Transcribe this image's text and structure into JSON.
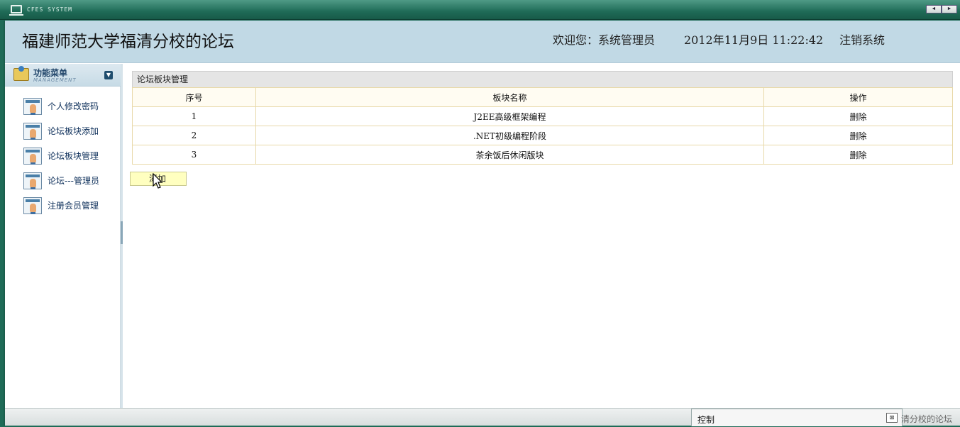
{
  "window": {
    "system_title": "CFES SYSTEM",
    "nav_prev": "◄",
    "nav_next": "►"
  },
  "header": {
    "site_title": "福建师范大学福清分校的论坛",
    "welcome": "欢迎您：系统管理员",
    "datetime": "2012年11月9日  11:22:42",
    "logout": "注销系统"
  },
  "sidebar": {
    "menu_title": "功能菜单",
    "menu_subtitle": "MANAGEMENT",
    "items": [
      {
        "label": "个人修改密码"
      },
      {
        "label": "论坛板块添加"
      },
      {
        "label": "论坛板块管理"
      },
      {
        "label": "论坛---管理员"
      },
      {
        "label": "注册会员管理"
      }
    ]
  },
  "main": {
    "panel_title": "论坛板块管理",
    "table": {
      "headers": [
        "序号",
        "板块名称",
        "操作"
      ],
      "rows": [
        {
          "no": "1",
          "name": "J2EE高级框架编程",
          "action": "删除"
        },
        {
          "no": "2",
          "name": ".NET初级编程阶段",
          "action": "删除"
        },
        {
          "no": "3",
          "name": "茶余饭后休闲版块",
          "action": "删除"
        }
      ]
    },
    "add_button": "添加"
  },
  "statusbar": {
    "control_label": "控制",
    "right_text": "清分校的论坛"
  },
  "colors": {
    "titlebar": "#1f6b57",
    "header_bg": "#c1d9e5",
    "table_border": "#e8d9a9",
    "add_button_bg": "#ffffc0"
  }
}
